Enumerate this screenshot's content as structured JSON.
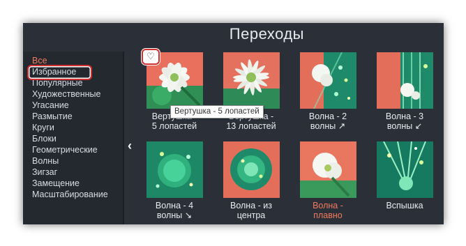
{
  "window": {
    "title": "Переходы"
  },
  "sidebar": {
    "categories": [
      "Все",
      "Избранное",
      "Популярные",
      "Художественные",
      "Угасание",
      "Размытие",
      "Круги",
      "Блоки",
      "Геометрические",
      "Волны",
      "Зигзаг",
      "Замещение",
      "Масштабирование"
    ],
    "active_index": 0
  },
  "tooltip": {
    "text": "Вертушка - 5 лопастей"
  },
  "tiles": [
    {
      "line1": "Вертушка -",
      "line2": "5 лопастей"
    },
    {
      "line1": "Вертушка -",
      "line2": "13 лопастей"
    },
    {
      "line1": "Волна - 2",
      "line2": "волны ↗"
    },
    {
      "line1": "Волна - 3",
      "line2": "волны ↙"
    },
    {
      "line1": "Волна - 4",
      "line2": "волны ↘"
    },
    {
      "line1": "Волна - из",
      "line2": "центра"
    },
    {
      "line1": "Волна -",
      "line2": "плавно"
    },
    {
      "line1": "Вспышка",
      "line2": ""
    }
  ],
  "icons": {
    "favorite": "heart-icon",
    "collapse": "chevron-left-icon"
  },
  "colors": {
    "window_bg": "#2b3038",
    "sidebar_bg": "#24282f",
    "accent": "#f27a5d",
    "highlight": "#d32f2f"
  }
}
